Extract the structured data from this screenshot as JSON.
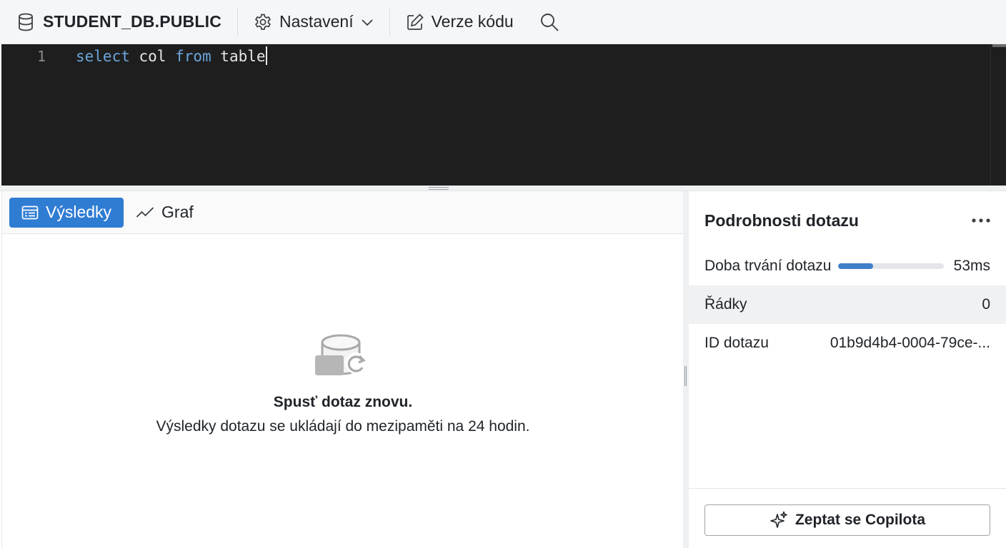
{
  "toolbar": {
    "database_label": "STUDENT_DB.PUBLIC",
    "settings_label": "Nastavení",
    "version_label": "Verze kódu"
  },
  "editor": {
    "line_number": "1",
    "code_tokens": [
      {
        "text": "select",
        "type": "keyword"
      },
      {
        "text": " col ",
        "type": "identifier"
      },
      {
        "text": "from",
        "type": "keyword"
      },
      {
        "text": " table",
        "type": "identifier"
      }
    ]
  },
  "results": {
    "tabs": [
      {
        "label": "Výsledky",
        "active": true,
        "icon": "table-icon"
      },
      {
        "label": "Graf",
        "active": false,
        "icon": "line-chart-icon"
      }
    ],
    "empty_icon": "database-refresh-icon",
    "empty_title": "Spusť dotaz znovu.",
    "empty_description": "Výsledky dotazu se ukládají do mezipaměti na 24 hodin."
  },
  "details": {
    "title": "Podrobnosti dotazu",
    "duration": {
      "label": "Doba trvání dotazu",
      "value": "53ms",
      "progress_fraction": 0.33
    },
    "rows": {
      "label": "Řádky",
      "value": "0"
    },
    "query_id": {
      "label": "ID dotazu",
      "value": "01b9d4b4-0004-79ce-..."
    },
    "copilot_button": "Zeptat se Copilota"
  },
  "colors": {
    "accent": "#2f7cd3",
    "editor_bg": "#1e1e1e",
    "keyword": "#6aa6dc",
    "progress": "#3f7fc8"
  }
}
